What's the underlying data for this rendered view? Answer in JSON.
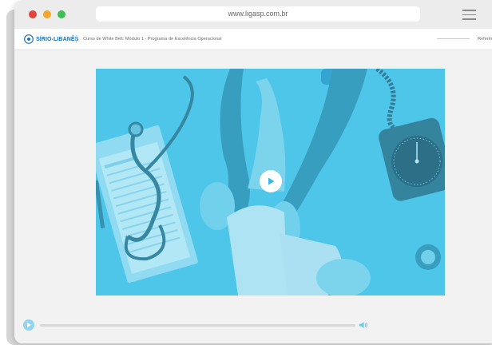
{
  "browser": {
    "url": "www.ligasp.com.br"
  },
  "header": {
    "logo_text": "SÍRIO-LIBANÊS",
    "course_title": "Curso de White Belt: Módulo 1 - Programa de Excelência Operacional",
    "right_link": "Referên"
  },
  "video": {
    "state": "paused",
    "play_icon": "play-icon",
    "progress": 0
  },
  "controls": {
    "play_icon": "play-icon",
    "volume_icon": "volume-icon"
  },
  "colors": {
    "accent": "#4ec7ea",
    "logo": "#1b6fb6",
    "window_bg": "#f2f2f2"
  }
}
